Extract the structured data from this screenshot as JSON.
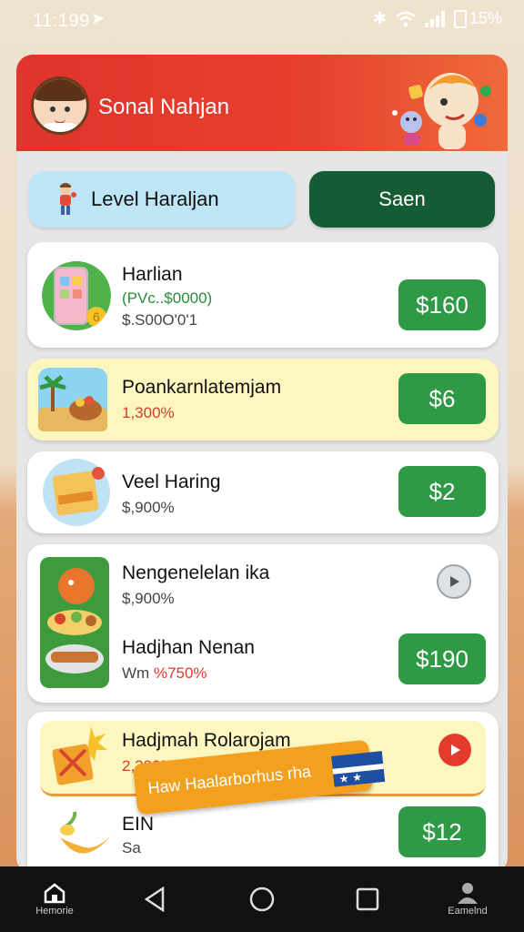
{
  "status_bar": {
    "time": "11:199",
    "battery": "15%"
  },
  "header": {
    "title": "Sonal Nahjan"
  },
  "actions": {
    "level_label": "Level Haraljan",
    "scan_label": "Saen"
  },
  "cards": [
    {
      "title": "Harlian",
      "line1": "(PVc..$0000)",
      "line2": "$.S00O'0'1",
      "price": "$160"
    },
    {
      "title": "Poankarnlatemjam",
      "line1": "1,300%",
      "price": "$6"
    },
    {
      "title": "Veel Haring",
      "line1": "$,900%",
      "price": "$2"
    },
    {
      "title": "Nengenelelan ika",
      "line1": "$,900%",
      "title2": "Hadjhan Nenan",
      "line2_prefix": "Wm",
      "line2": "%750%",
      "price": "$190"
    },
    {
      "title": "Hadjmah Rolarojam",
      "line1": "2,380%",
      "title2": "EIN",
      "line2": "Sa",
      "price": "$12"
    }
  ],
  "toast": {
    "text": "Haw Haalarborhus rha"
  },
  "nav": {
    "home_label": "Hemorie",
    "profile_label": "Eamelnd"
  },
  "colors": {
    "header_red": "#e0342c",
    "price_green": "#2f9a45",
    "scan_green": "#155c35",
    "level_blue": "#bfe6f7",
    "highlight_yellow": "#fdf7bf",
    "toast_orange": "#f3a01f"
  },
  "icons": [
    "location-icon",
    "bluetooth-icon",
    "wifi-icon",
    "signal-icon",
    "battery-icon",
    "avatar",
    "mascot-illustration",
    "kid-icon",
    "play-icon",
    "home-icon",
    "back-icon",
    "circle-home-icon",
    "recents-icon",
    "profile-icon"
  ]
}
